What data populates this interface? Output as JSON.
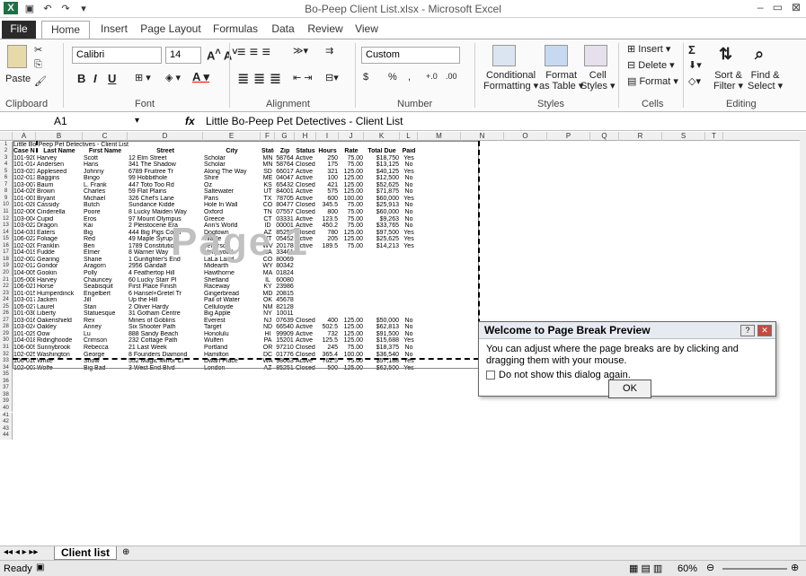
{
  "window": {
    "title": "Bo-Peep Client List.xlsx - Microsoft Excel",
    "minimize": "–",
    "maximize": "▭",
    "close": "⊠"
  },
  "ribbon_tabs": [
    "File",
    "Home",
    "Insert",
    "Page Layout",
    "Formulas",
    "Data",
    "Review",
    "View"
  ],
  "ribbon": {
    "clipboard": {
      "paste": "Paste",
      "label": "Clipboard"
    },
    "font": {
      "name": "Calibri",
      "size": "14",
      "label": "Font",
      "bold": "B",
      "italic": "I",
      "underline": "U"
    },
    "alignment": {
      "label": "Alignment"
    },
    "number": {
      "format": "Custom",
      "label": "Number",
      "currency": "$",
      "percent": "%",
      "comma": ",",
      "inc": "+.0 .00",
      "dec": ".00 →.0"
    },
    "styles": {
      "conditional": "Conditional",
      "conditional2": "Formatting",
      "format_table": "Format",
      "format_table2": "as Table",
      "cell_styles": "Cell",
      "cell_styles2": "Styles",
      "label": "Styles"
    },
    "cells": {
      "insert": "Insert",
      "delete": "Delete",
      "format": "Format",
      "label": "Cells"
    },
    "editing": {
      "sum": "Σ",
      "sort": "Sort &",
      "sort2": "Filter",
      "find": "Find &",
      "find2": "Select",
      "label": "Editing"
    }
  },
  "formula_bar": {
    "name_box": "A1",
    "fx": "fx",
    "content": "Little Bo-Peep Pet Detectives - Client List"
  },
  "columns": [
    "A",
    "B",
    "C",
    "D",
    "E",
    "F",
    "G",
    "H",
    "I",
    "J",
    "K",
    "L",
    "M",
    "N",
    "O",
    "P",
    "Q",
    "R",
    "S",
    "T"
  ],
  "sheet_title": "Little Bo-Peep Pet Detectives - Client List",
  "headers": [
    "Case No",
    "Last Name",
    "First Name",
    "Street",
    "City",
    "State",
    "Zip",
    "Status",
    "Hours",
    "Rate",
    "Total Due",
    "Paid"
  ],
  "rows": [
    [
      "101-920",
      "Harvey",
      "Scott",
      "12 Elm Street",
      "Scholar",
      "MN",
      "58764",
      "Active",
      "250",
      "75.00",
      "$18,750",
      "Yes"
    ],
    [
      "101-014",
      "Andersen",
      "Hans",
      "341 The Shadow",
      "Scholar",
      "MN",
      "58764",
      "Closed",
      "175",
      "75.00",
      "$13,125",
      "No"
    ],
    [
      "103-023",
      "Appleseed",
      "Johnny",
      "6789 Fruitree Tr",
      "Along The Way",
      "SD",
      "66017",
      "Active",
      "321",
      "125.00",
      "$40,125",
      "Yes"
    ],
    [
      "102-013",
      "Baggins",
      "Bingo",
      "99 Hobbithole",
      "Shire",
      "ME",
      "04047",
      "Active",
      "100",
      "125.00",
      "$12,500",
      "No"
    ],
    [
      "103-007",
      "Baum",
      "L. Frank",
      "447 Toto Too Rd",
      "Oz",
      "KS",
      "65432",
      "Closed",
      "421",
      "125.00",
      "$52,625",
      "No"
    ],
    [
      "104-026",
      "Brown",
      "Charles",
      "59 Flat Plains",
      "Saltewater",
      "UT",
      "84001",
      "Active",
      "575",
      "125.00",
      "$71,875",
      "No"
    ],
    [
      "101-001",
      "Bryant",
      "Michael",
      "326 Chef's Lane",
      "Paris",
      "TX",
      "78705",
      "Active",
      "600",
      "100.00",
      "$60,000",
      "Yes"
    ],
    [
      "101-028",
      "Cassidy",
      "Butch",
      "Sundance Kidde",
      "Hole In Wall",
      "CO",
      "80477",
      "Closed",
      "345.5",
      "75.00",
      "$25,913",
      "No"
    ],
    [
      "102-006",
      "Cinderella",
      "Poore",
      "8 Lucky Maiden Way",
      "Oxford",
      "TN",
      "07557",
      "Closed",
      "800",
      "75.00",
      "$60,000",
      "No"
    ],
    [
      "103-004",
      "Cupid",
      "Eros",
      "97 Mount Olympus",
      "Greece",
      "CT",
      "03331",
      "Active",
      "123.5",
      "75.00",
      "$9,263",
      "No"
    ],
    [
      "103-022",
      "Dragon",
      "Kai",
      "2 Pleistocene Era",
      "Ann's World",
      "ID",
      "00001",
      "Active",
      "450.2",
      "75.00",
      "$33,765",
      "No"
    ],
    [
      "104-031",
      "Eaters",
      "Big",
      "444 Big Pigs Court",
      "Dogtown",
      "AZ",
      "85257",
      "Closed",
      "780",
      "125.00",
      "$97,500",
      "Yes"
    ],
    [
      "106-022",
      "Foliage",
      "Red",
      "49 Maple Syrup",
      "Waffle",
      "VT",
      "05452",
      "Active",
      "205",
      "125.00",
      "$25,625",
      "Yes"
    ],
    [
      "102-020",
      "Franklin",
      "Ben",
      "1789 Constitution",
      "Jefferson",
      "WV",
      "20178",
      "Active",
      "189.5",
      "75.00",
      "$14,213",
      "Yes"
    ],
    [
      "104-019",
      "Fudde",
      "Elmer",
      "8 Warner Way",
      "Hollywood",
      "CA",
      "33461",
      "",
      "",
      "",
      "",
      ""
    ],
    [
      "102-002",
      "Gearing",
      "Shane",
      "1 Gunfighter's End",
      "LaLa Land",
      "CO",
      "80069",
      "",
      "",
      "",
      "",
      ""
    ],
    [
      "102-012",
      "Gondor",
      "Aragorn",
      "2956 Gandalf",
      "Midearth",
      "WY",
      "80342",
      "",
      "",
      "",
      "",
      ""
    ],
    [
      "104-005",
      "Gookin",
      "Polly",
      "4 Feathertop Hill",
      "Hawthorne",
      "MA",
      "01824",
      "",
      "",
      "",
      "",
      ""
    ],
    [
      "105-008",
      "Harvey",
      "Chauncey",
      "60 Lucky Starr Pl",
      "Shetland",
      "IL",
      "60080",
      "",
      "",
      "",
      "",
      ""
    ],
    [
      "106-021",
      "Horse",
      "Seabisquit",
      "First Place Finish",
      "Raceway",
      "KY",
      "23986",
      "",
      "",
      "",
      "",
      ""
    ],
    [
      "101-015",
      "Humperdinck",
      "Engelbert",
      "6 Hansel+Gretel Tr",
      "Gingerbread",
      "MD",
      "20815",
      "",
      "",
      "",
      "",
      ""
    ],
    [
      "103-017",
      "Jacken",
      "Jill",
      "Up the Hill",
      "Pail of Water",
      "OK",
      "45678",
      "",
      "",
      "",
      "",
      ""
    ],
    [
      "105-027",
      "Laurel",
      "Stan",
      "2 Oliver Hardy",
      "Celluloyde",
      "NM",
      "82128",
      "",
      "",
      "",
      "",
      ""
    ],
    [
      "101-030",
      "Liberty",
      "Statuesque",
      "31 Gotham Centre",
      "Big Apple",
      "NY",
      "10011",
      "",
      "",
      "",
      "",
      ""
    ],
    [
      "103-016",
      "Oakenshield",
      "Rex",
      "Mines of Goblins",
      "Everest",
      "NJ",
      "07639",
      "Closed",
      "400",
      "125.00",
      "$50,000",
      "No"
    ],
    [
      "103-024",
      "Oakley",
      "Anney",
      "Six Shooter Path",
      "Target",
      "ND",
      "66540",
      "Active",
      "502.5",
      "125.00",
      "$62,813",
      "No"
    ],
    [
      "101-029",
      "Oow",
      "Lu",
      "888 Sandy Beach",
      "Honolulu",
      "HI",
      "99909",
      "Active",
      "732",
      "125.00",
      "$91,500",
      "No"
    ],
    [
      "104-018",
      "Ridinghoode",
      "Crimson",
      "232 Cottage Path",
      "Wulfen",
      "PA",
      "15201",
      "Active",
      "125.5",
      "125.00",
      "$15,688",
      "Yes"
    ],
    [
      "106-009",
      "Sunnybrook",
      "Rebecca",
      "21 Last Week",
      "Portland",
      "OR",
      "97210",
      "Closed",
      "245",
      "75.00",
      "$18,375",
      "No"
    ],
    [
      "102-025",
      "Washington",
      "George",
      "8 Founders Diamond",
      "Hamilton",
      "DC",
      "01776",
      "Closed",
      "365.4",
      "100.00",
      "$36,540",
      "No"
    ],
    [
      "106-010",
      "White",
      "Snow",
      "552 Magic Mirror Ct",
      "Dwarf Place",
      "WA",
      "98063",
      "Active",
      "762.5",
      "75.00",
      "$57,188",
      "Yes"
    ],
    [
      "102-003",
      "Wolfe",
      "Big Bad",
      "3 West End Blvd",
      "London",
      "AZ",
      "85251",
      "Closed",
      "500",
      "125.00",
      "$62,500",
      "Yes"
    ]
  ],
  "watermark": "Page 1",
  "dialog": {
    "title": "Welcome to Page Break Preview",
    "body": "You can adjust where the page breaks are by clicking and dragging them with your mouse.",
    "checkbox": "Do not show this dialog again.",
    "ok": "OK"
  },
  "sheet_tab": "Client list",
  "status": {
    "ready": "Ready",
    "zoom": "60%"
  }
}
